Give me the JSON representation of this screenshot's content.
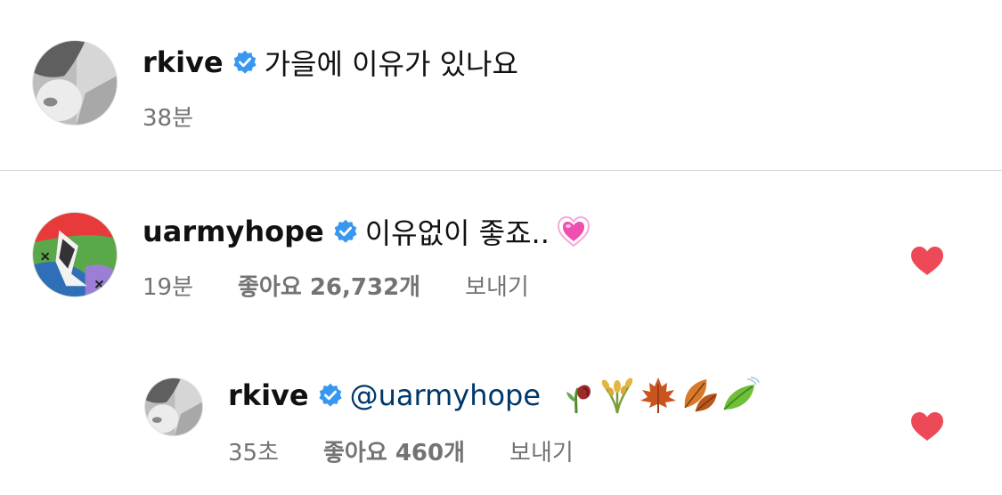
{
  "post": {
    "username": "rkive",
    "caption": "가을에 이유가 있나요",
    "time": "38분"
  },
  "comments": [
    {
      "username": "uarmyhope",
      "text": "이유없이 좋죠..",
      "emoji": "growing-heart",
      "time": "19분",
      "likes": "좋아요 26,732개",
      "reply_label": "보내기",
      "liked": true,
      "heart_color": "#ed4956"
    },
    {
      "username": "rkive",
      "mention": "@uarmyhope",
      "emojis": [
        "wilted-flower",
        "sheaf-of-rice",
        "maple-leaf",
        "fallen-leaf",
        "leaf-fluttering-in-wind"
      ],
      "time": "35초",
      "likes": "좋아요 460개",
      "reply_label": "보내기",
      "liked": true,
      "heart_color": "#ed4956"
    }
  ],
  "colors": {
    "verified": "#3897f0",
    "secondary_text": "#737373",
    "mention": "#00376b",
    "divider": "#dbdbdb"
  }
}
